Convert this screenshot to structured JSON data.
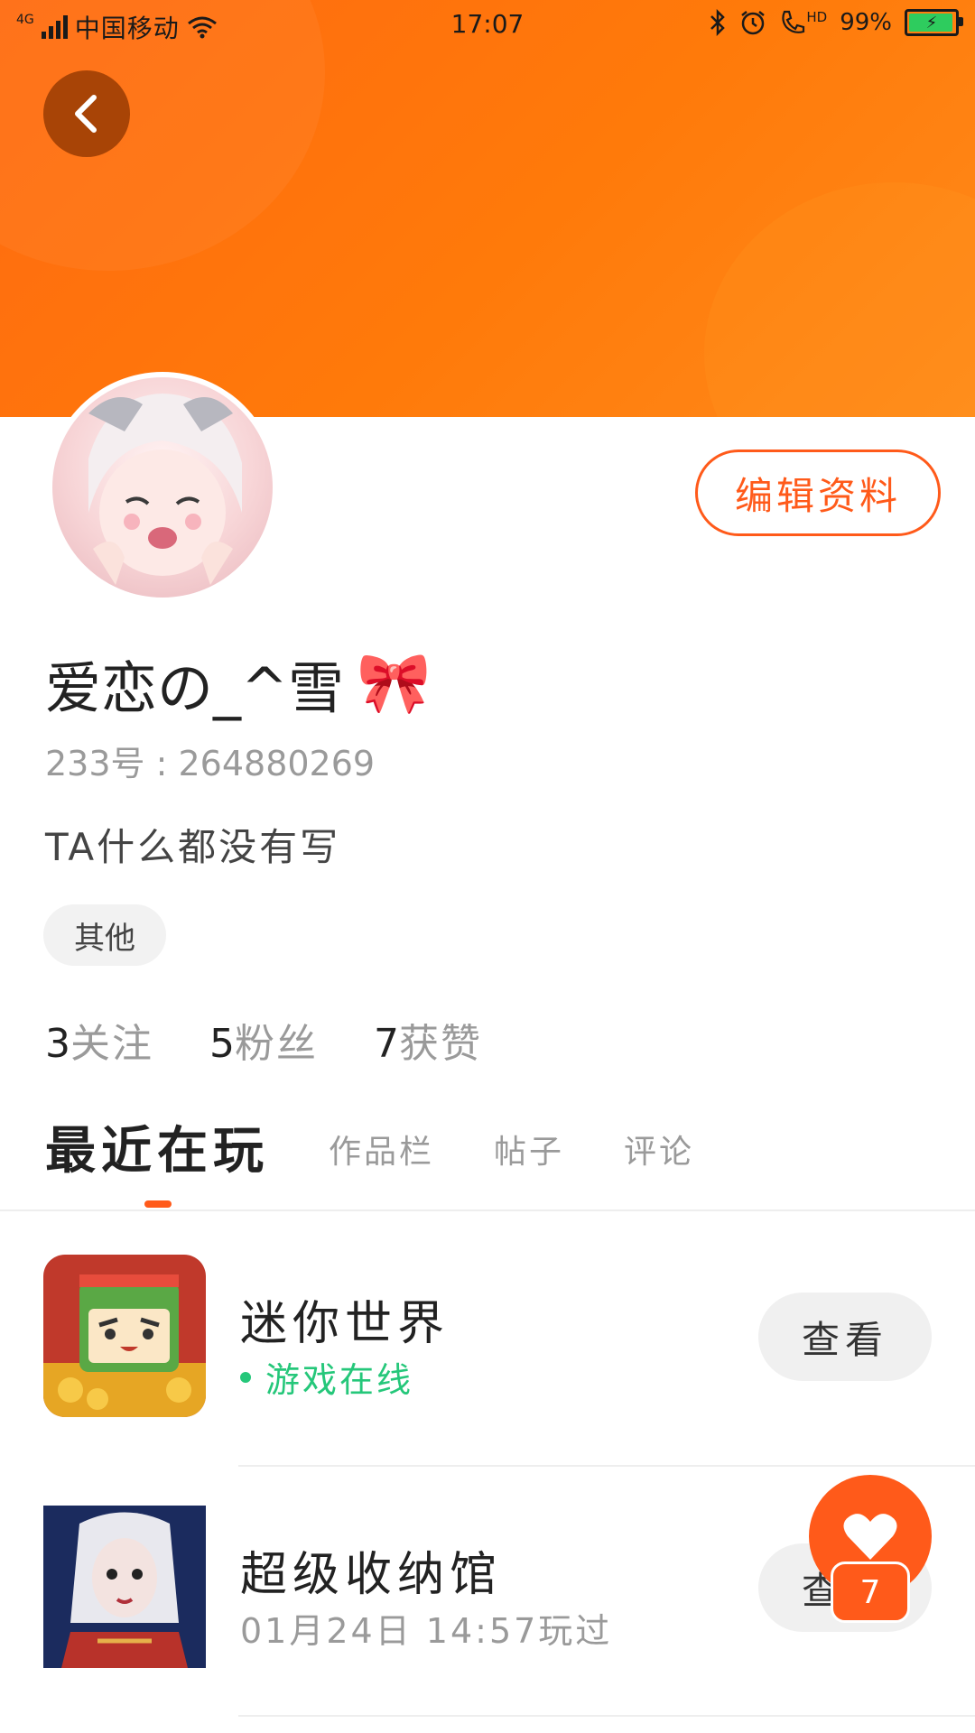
{
  "status_bar": {
    "network_type": "4G",
    "carrier": "中国移动",
    "time": "17:07",
    "hd_label": "HD",
    "battery": "99%"
  },
  "profile": {
    "edit_label": "编辑资料",
    "username": "爱恋の_^雪",
    "username_emoji": "🎀",
    "id_text": "233号 : 264880269",
    "bio": "TA什么都没有写",
    "tag": "其他"
  },
  "stats": [
    {
      "count": "3",
      "label": "关注"
    },
    {
      "count": "5",
      "label": "粉丝"
    },
    {
      "count": "7",
      "label": "获赞"
    }
  ],
  "tabs": [
    {
      "label": "最近在玩",
      "active": true
    },
    {
      "label": "作品栏",
      "active": false
    },
    {
      "label": "帖子",
      "active": false
    },
    {
      "label": "评论",
      "active": false
    }
  ],
  "games": [
    {
      "title": "迷你世界",
      "status": "游戏在线",
      "status_color": "#25c77a",
      "button": "查看"
    },
    {
      "title": "超级收纳馆",
      "status": "01月24日 14:57玩过",
      "status_color": "#9a9a9a",
      "button": "查看"
    }
  ],
  "fab": {
    "count": "7"
  },
  "colors": {
    "accent": "#ff5a1a",
    "banner": "#ff7a0a",
    "online": "#25c77a"
  }
}
